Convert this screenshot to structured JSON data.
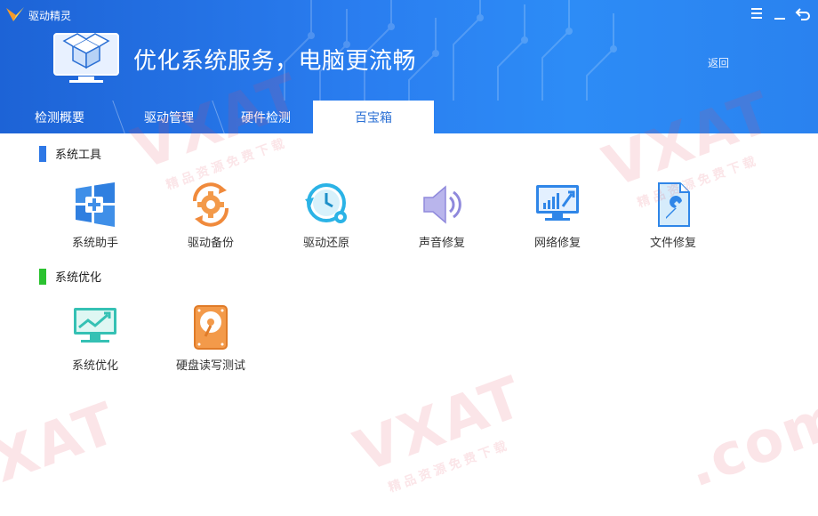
{
  "app": {
    "title": "驱动精灵"
  },
  "header": {
    "headline": "优化系统服务，电脑更流畅",
    "back_label": "返回"
  },
  "tabs": [
    {
      "label": "检测概要",
      "active": false
    },
    {
      "label": "驱动管理",
      "active": false
    },
    {
      "label": "硬件检测",
      "active": false
    },
    {
      "label": "百宝箱",
      "active": true
    }
  ],
  "sections": [
    {
      "title": "系统工具",
      "accent": "#2e78e6",
      "tools": [
        {
          "label": "系统助手",
          "icon": "windows-plus-icon"
        },
        {
          "label": "驱动备份",
          "icon": "gear-backup-icon"
        },
        {
          "label": "驱动还原",
          "icon": "clock-restore-icon"
        },
        {
          "label": "声音修复",
          "icon": "speaker-icon"
        },
        {
          "label": "网络修复",
          "icon": "network-monitor-icon"
        },
        {
          "label": "文件修复",
          "icon": "file-wrench-icon"
        }
      ]
    },
    {
      "title": "系统优化",
      "accent": "#2bc230",
      "tools": [
        {
          "label": "系统优化",
          "icon": "monitor-chart-icon"
        },
        {
          "label": "硬盘读写测试",
          "icon": "hard-disk-icon"
        }
      ]
    }
  ],
  "watermark": {
    "brand": "VXAT",
    "domain": ".com",
    "tagline": "精品资源免费下载"
  },
  "colors": {
    "header": "#2a7ef0",
    "tab_active_text": "#2a6fd4"
  }
}
